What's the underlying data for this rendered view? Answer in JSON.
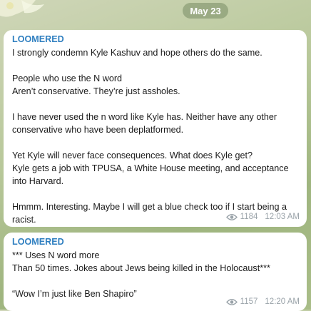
{
  "date_pill": "May 23",
  "messages": [
    {
      "sender": "LOOMERED",
      "paragraphs": [
        "I strongly condemn Kyle Kashuv and hope others do the same.",
        "People who use the N word\nAren’t conservative. They’re just assholes.",
        "I have never used the n word like Kyle has. Neither have any other conservative who have been deplatformed.",
        "Yet Kyle will never face consequences. What does Kyle get?\nKyle gets a job with TPUSA, a White House meeting, and acceptance into Harvard.",
        "Hmmm. Interesting. Maybe I will get a blue check too if I start being a racist."
      ],
      "views": "1184",
      "time": "12:03 AM",
      "view_icon": "eye-icon"
    },
    {
      "sender": "LOOMERED",
      "paragraphs": [
        "*** Uses N word more\nThan 50 times. Jokes about Jews being killed in the Holocaust***",
        "“Wow I’m just like Ben Shapiro”"
      ],
      "views": "1157",
      "time": "12:20 AM",
      "view_icon": "eye-icon"
    }
  ],
  "colors": {
    "sender": "#2f7fc0",
    "meta": "#9aa3a9",
    "bubble": "#ffffff"
  }
}
